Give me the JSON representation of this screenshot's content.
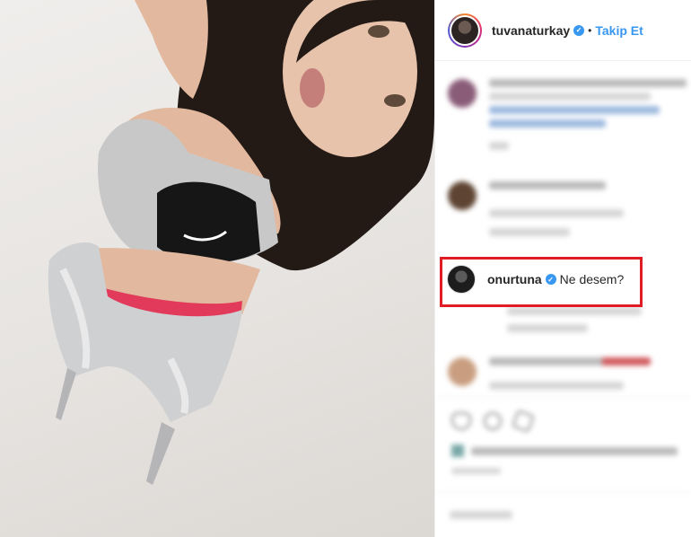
{
  "post": {
    "author": {
      "username": "tuvanaturkay",
      "verified": true,
      "follow_label": "Takip Et",
      "separator": "•"
    },
    "highlighted_comment": {
      "username": "onurtuna",
      "verified": true,
      "text": "Ne desem?"
    },
    "colors": {
      "accent": "#3897f0",
      "highlight_border": "#e01c24",
      "text": "#262626"
    },
    "icons": [
      "verified-badge-icon",
      "heart-icon",
      "comment-icon",
      "share-icon"
    ]
  }
}
